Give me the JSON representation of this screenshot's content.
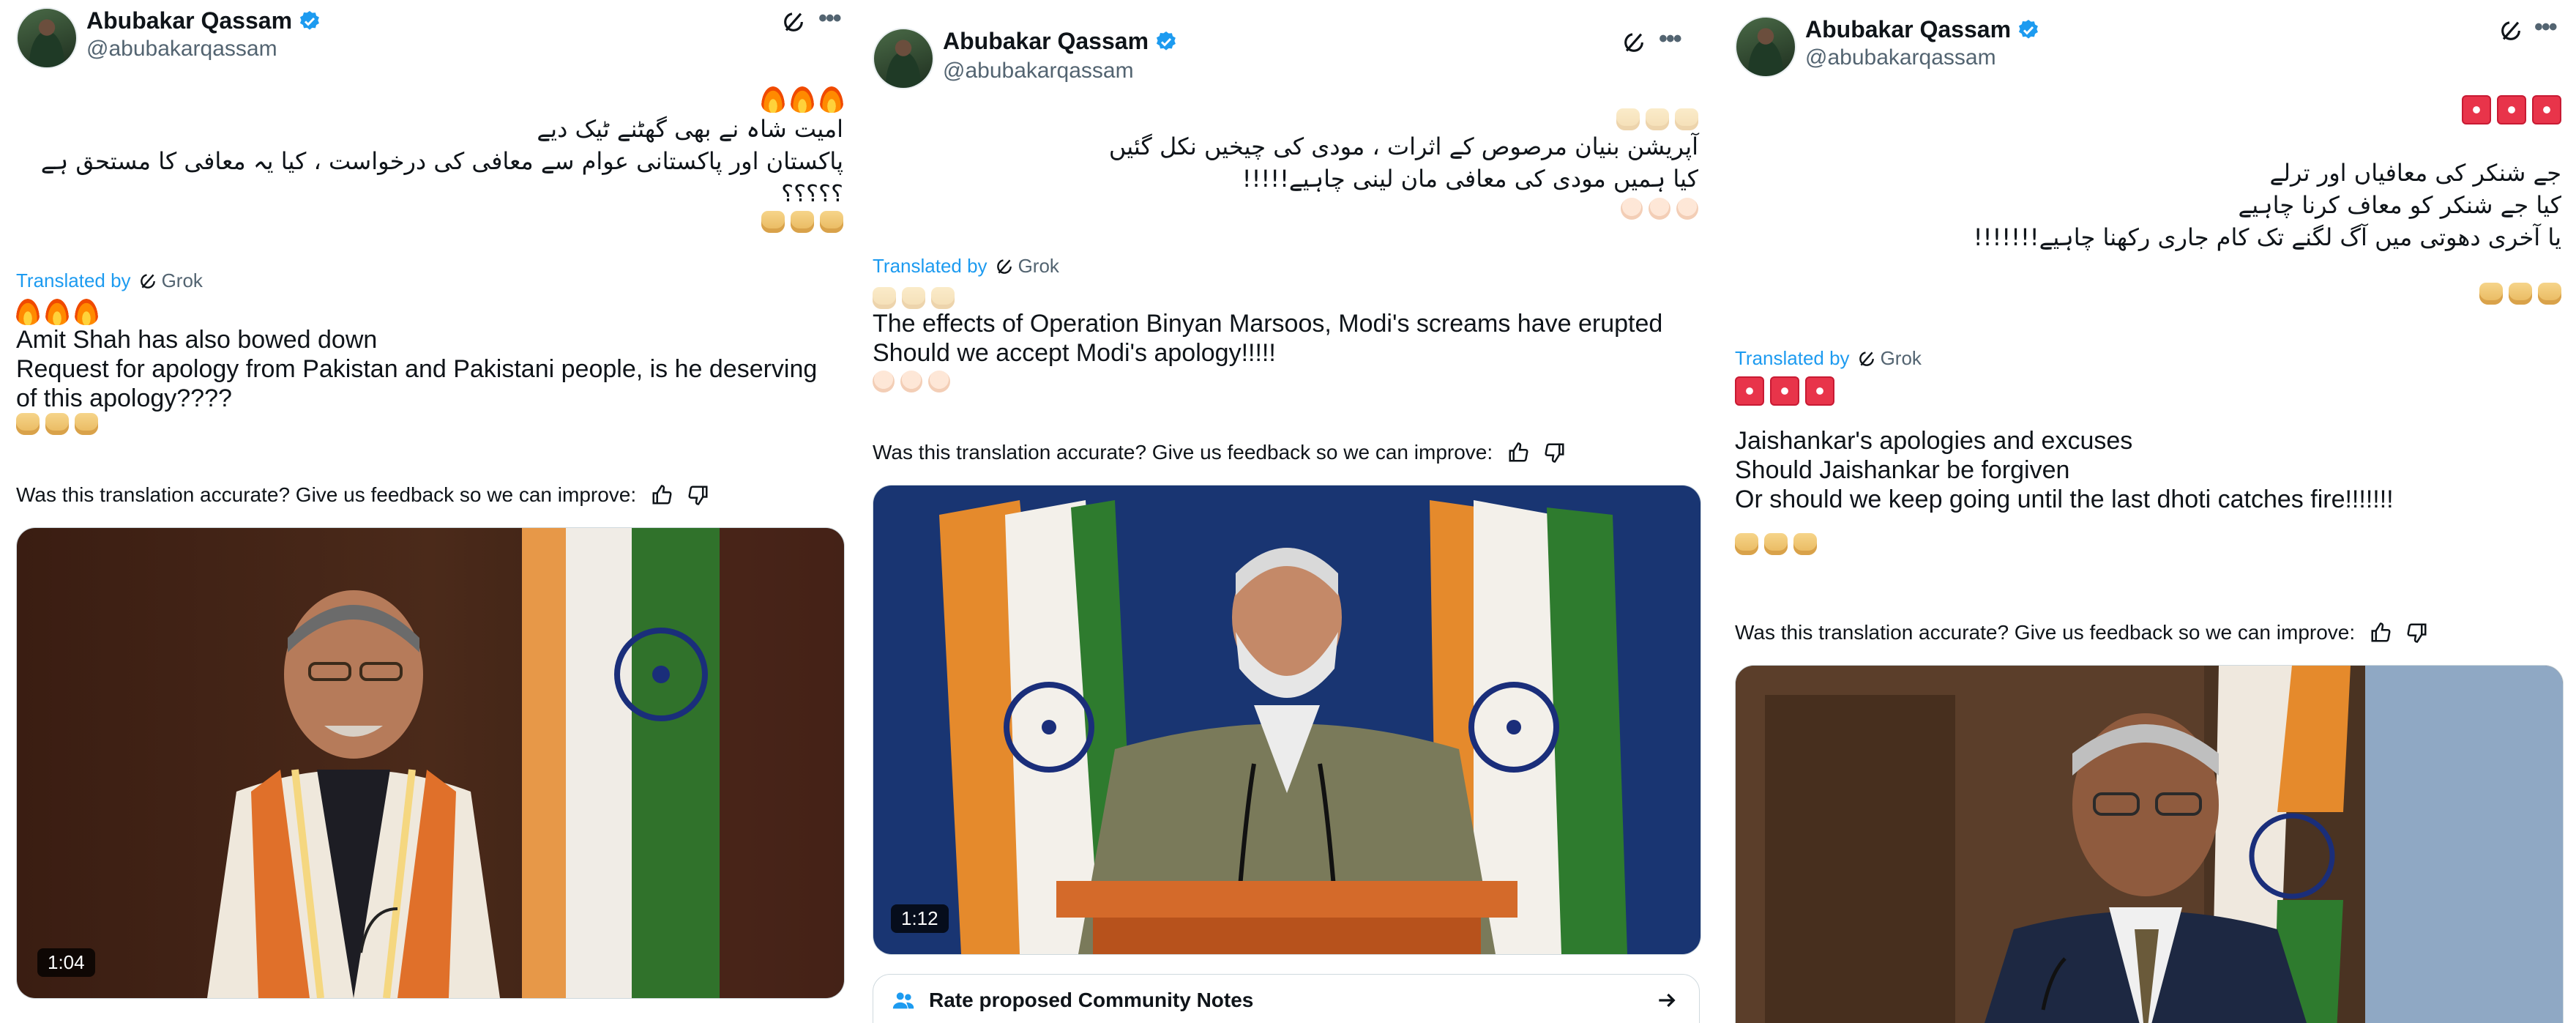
{
  "tweets": [
    {
      "author": {
        "name": "Abubakar Qassam",
        "handle": "@abubakarqassam"
      },
      "urdu_lines": [
        "امیت شاہ نے بھی گھٹنے ٹیک دیے",
        "پاکستان اور پاکستانی عوام سے معافی کی درخواست ، کیا یہ معافی کا مستحق ہے",
        "؟؟؟؟؟"
      ],
      "translated_by": "Translated by",
      "translator": "Grok",
      "english_lines": [
        "Amit Shah has also bowed down",
        "Request for apology from Pakistan and Pakistani people, is he deserving",
        "of this apology????"
      ],
      "feedback_text": "Was this translation accurate? Give us feedback so we can improve:",
      "media": {
        "duration": "1:04"
      }
    },
    {
      "author": {
        "name": "Abubakar Qassam",
        "handle": "@abubakarqassam"
      },
      "urdu_lines": [
        "آپریشن بنیان مرصوص کے اثرات ، مودی کی چیخیں نکل گئیں",
        "کیا ہمیں مودی کی معافی مان لینی چاہیے!!!!!"
      ],
      "translated_by": "Translated by",
      "translator": "Grok",
      "english_lines": [
        "The effects of Operation Binyan Marsoos, Modi's screams have erupted",
        "Should we accept Modi's apology!!!!!"
      ],
      "feedback_text": "Was this translation accurate? Give us feedback so we can improve:",
      "media": {
        "duration": "1:12"
      },
      "community_notes_label": "Rate proposed Community Notes"
    },
    {
      "author": {
        "name": "Abubakar Qassam",
        "handle": "@abubakarqassam"
      },
      "urdu_lines": [
        "جے شنکر کی معافیاں اور ترلے",
        "کیا جے شنکر کو معاف کرنا چاہیے",
        "یا آخری دھوتی میں آگ لگنے تک کام جاری رکھنا چاہیے!!!!!!!"
      ],
      "translated_by": "Translated by",
      "translator": "Grok",
      "english_lines": [
        "Jaishankar's apologies and excuses",
        "Should Jaishankar be forgiven",
        "Or should we keep going until the last dhoti catches fire!!!!!!!"
      ],
      "feedback_text": "Was this translation accurate? Give us feedback so we can improve:"
    }
  ],
  "colors": {
    "link": "#1d9bf0",
    "verified": "#1d9bf0",
    "secondary_text": "#536471"
  }
}
